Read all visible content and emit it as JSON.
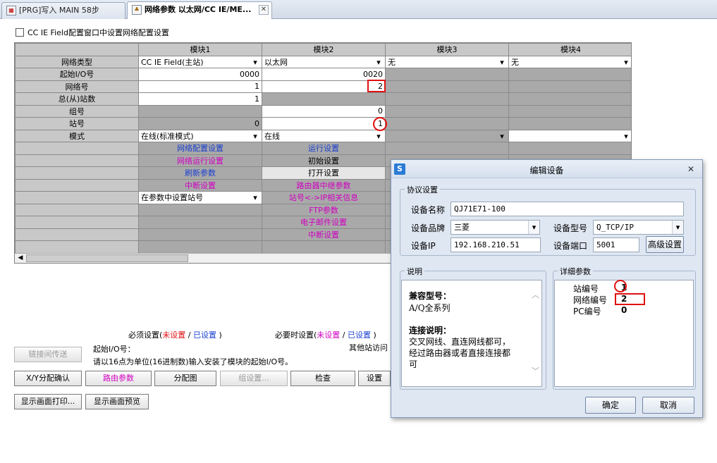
{
  "tabs": [
    {
      "label": "[PRG]写入 MAIN 58步",
      "icon": "program-icon"
    },
    {
      "label": "网络参数 以太网/CC IE/ME...",
      "icon": "network-param-icon"
    }
  ],
  "config_checkbox": "CC IE Field配置窗口中设置网络配置设置",
  "grid": {
    "columns": [
      "模块1",
      "模块2",
      "模块3",
      "模块4"
    ],
    "rows": {
      "network_type": {
        "label": "网络类型",
        "m1": "CC IE Field(主站)",
        "m2": "以太网",
        "m3": "无",
        "m4": "无"
      },
      "start_io": {
        "label": "起始I/O号",
        "m1": "0000",
        "m2": "0020"
      },
      "network_no": {
        "label": "网络号",
        "m1": "1",
        "m2": "2"
      },
      "total_stations": {
        "label": "总(从)站数",
        "m1": "1"
      },
      "group_no": {
        "label": "组号",
        "m2": "0"
      },
      "station_no": {
        "label": "站号",
        "m1": "0",
        "m2": "1"
      },
      "mode": {
        "label": "模式",
        "m1": "在线(标准模式)",
        "m2": "在线"
      }
    },
    "m1_links": {
      "net_config": "网络配置设置",
      "net_operation": "网络运行设置",
      "refresh": "刷新参数",
      "interrupt": "中断设置",
      "station_setting": "在参数中设置站号"
    },
    "m2_links": {
      "operation": "运行设置",
      "initial": "初始设置",
      "open": "打开设置",
      "router_relay": "路由器中继参数",
      "station_ip": "站号<->IP相关信息",
      "ftp": "FTP参数",
      "email": "电子邮件设置",
      "interrupt": "中断设置"
    }
  },
  "legend": {
    "required_prefix": "必须设置(",
    "required_unset": "未设置",
    "slash": "/",
    "required_set": "已设置",
    "required_suffix": ")",
    "optional_prefix": "必要时设置(",
    "optional_unset": "未设置",
    "optional_set": "已设置",
    "optional_suffix": ")"
  },
  "info": {
    "link_transfer": "链接间传送",
    "other": "其他站访问",
    "field": "起始I/O号：",
    "hint": "请以16点为单位(16进制数)输入安装了模块的起始I/O号。"
  },
  "buttons": {
    "xy_confirm": "X/Y分配确认",
    "routing": "路由参数",
    "assign_map": "分配图",
    "group_setting": "组设置...",
    "check": "检查",
    "settings": "设置",
    "print": "显示画面打印...",
    "preview": "显示画面预览"
  },
  "dialog": {
    "title": "编辑设备",
    "app_icon": "S",
    "protocol_group": "协议设置",
    "device_name_label": "设备名称",
    "device_name": "QJ71E71-100",
    "brand_label": "设备品牌",
    "brand": "三菱",
    "model_label": "设备型号",
    "model": "Q_TCP/IP",
    "ip_label": "设备IP",
    "ip": "192.168.210.51",
    "port_label": "设备端口",
    "port": "5001",
    "advanced": "高级设置",
    "desc_group": "说明",
    "compat_title": "兼容型号：",
    "compat_value": "A/Q全系列",
    "conn_title": "连接说明：",
    "conn_line1": "交叉网线、直连网线都可，",
    "conn_line2": "经过路由器或者直接连接都",
    "conn_line3": "可",
    "detail_group": "详细参数",
    "station_label": "站编号",
    "station_value": "1",
    "network_label": "网络编号",
    "network_value": "2",
    "pc_label": "PC编号",
    "pc_value": "0",
    "ok": "确定",
    "cancel": "取消"
  }
}
